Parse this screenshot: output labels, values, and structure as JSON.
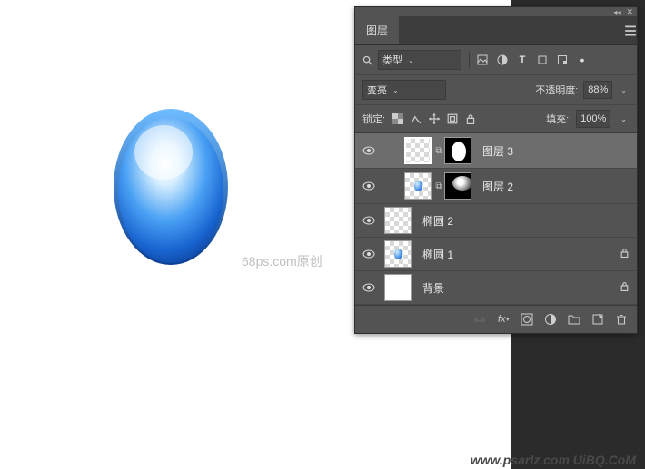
{
  "canvas": {
    "watermark": "68ps.com原创",
    "footer_watermark": "www.psarlz.com UiBQ.CoM"
  },
  "panel": {
    "title_tab": "图层",
    "filter": {
      "search_icon": "search-icon",
      "mode_label": "类型",
      "filter_icons": [
        "image-filter-icon",
        "adjustment-filter-icon",
        "text-filter-icon",
        "shape-filter-icon",
        "smartobject-filter-icon",
        "dot-toggle-icon"
      ]
    },
    "blend": {
      "mode_label": "变亮"
    },
    "opacity": {
      "label": "不透明度:",
      "value": "88%"
    },
    "lock": {
      "label": "锁定:",
      "fill_label": "填充:",
      "fill_value": "100%"
    },
    "layers": [
      {
        "name": "图层 3",
        "has_mask": true,
        "indent": 1,
        "selected": true,
        "locked": false,
        "thumb": "checker",
        "mask_thumb": "ellipse"
      },
      {
        "name": "图层 2",
        "has_mask": true,
        "indent": 1,
        "selected": false,
        "locked": false,
        "thumb": "checker-egg",
        "mask_thumb": "blur"
      },
      {
        "name": "椭圆 2",
        "has_mask": false,
        "indent": 0,
        "selected": false,
        "locked": false,
        "thumb": "checker"
      },
      {
        "name": "椭圆 1",
        "has_mask": false,
        "indent": 0,
        "selected": false,
        "locked": true,
        "thumb": "checker-egg"
      },
      {
        "name": "背景",
        "has_mask": false,
        "indent": 0,
        "selected": false,
        "locked": true,
        "thumb": "white"
      }
    ],
    "footer_icons": [
      "link-icon",
      "fx-icon",
      "mask-icon",
      "adjust-icon",
      "group-icon",
      "new-layer-icon",
      "trash-icon"
    ]
  }
}
